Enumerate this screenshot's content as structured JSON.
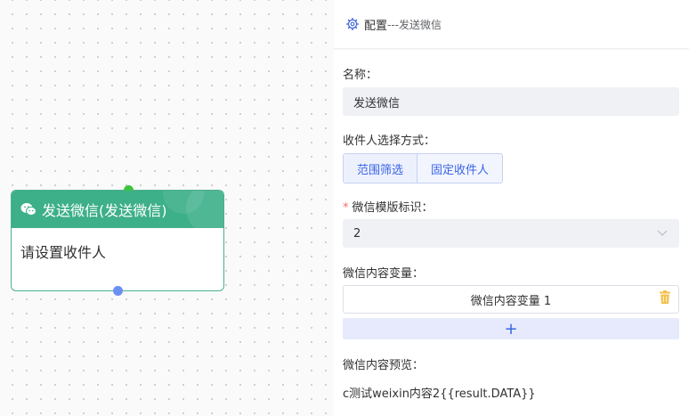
{
  "node": {
    "title": "发送微信(发送微信)",
    "body": "请设置收件人"
  },
  "panel": {
    "title": "配置",
    "subtitle": "---发送微信",
    "name_label": "名称：",
    "name_value": "发送微信",
    "recipient_mode_label": "收件人选择方式：",
    "recipient_modes": [
      "范围筛选",
      "固定收件人"
    ],
    "template_label": "微信模版标识：",
    "template_value": "2",
    "variables_label": "微信内容变量：",
    "variable_item": "微信内容变量 1",
    "add_symbol": "+",
    "preview_label": "微信内容预览：",
    "preview_text": "c测试weixin内容2{{result.DATA}}"
  },
  "colors": {
    "node_header": "#3daf89",
    "accent": "#3a64e6",
    "required": "#f56c6c",
    "port_top": "#3cc43c",
    "port_bottom": "#6b8ff2"
  },
  "icons": {
    "node_icon": "wechat-icon",
    "panel_icon": "gear-icon",
    "select_icon": "chevron-down-icon",
    "delete_icon": "trash-icon"
  }
}
